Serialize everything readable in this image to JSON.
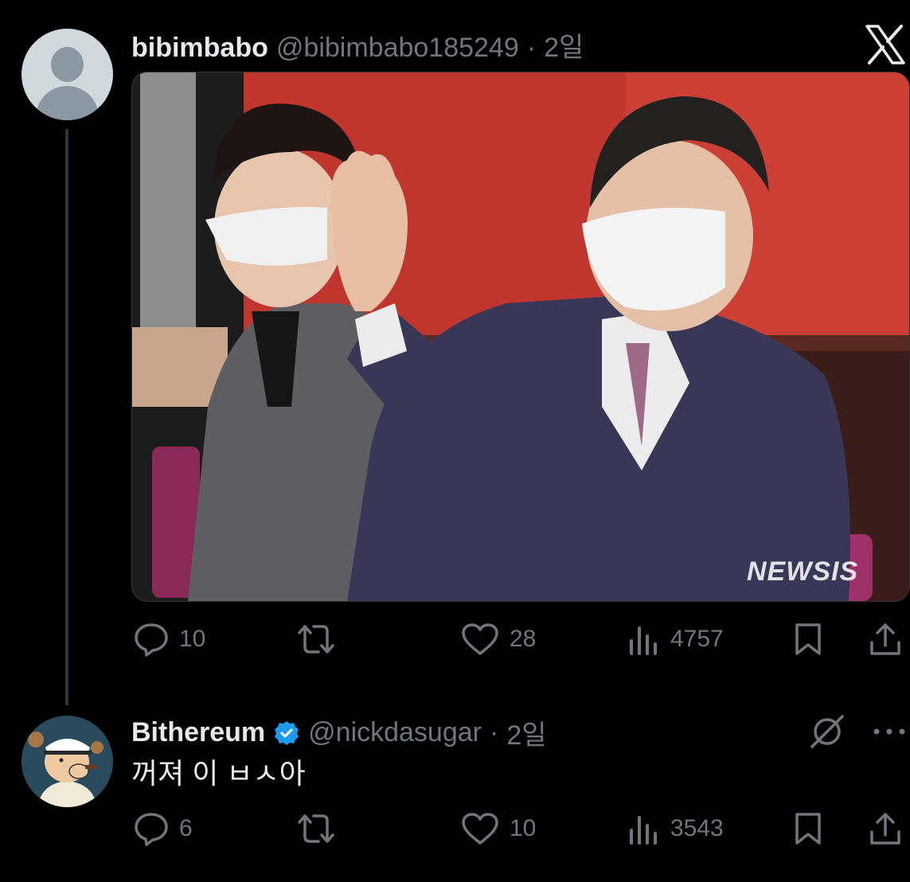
{
  "tweet": {
    "display_name": "bibimbabo",
    "handle": "@bibimbabo185249",
    "separator": "·",
    "time": "2일",
    "image_watermark": "NEWSIS",
    "metrics": {
      "replies": "10",
      "likes": "28",
      "views": "4757"
    }
  },
  "reply": {
    "display_name": "Bithereum",
    "handle": "@nickdasugar",
    "separator": "·",
    "time": "2일",
    "text": "꺼져 이 ㅂㅅ아",
    "metrics": {
      "replies": "6",
      "likes": "10",
      "views": "3543"
    }
  },
  "colors": {
    "background": "#000000",
    "primary_text": "#e7e9ea",
    "secondary_text": "#71767b",
    "verified_badge": "#1d9bf0",
    "divider": "#333639"
  },
  "icons": {
    "brand": "x-logo-icon",
    "reply": "reply-icon",
    "retweet": "retweet-icon",
    "like": "like-icon",
    "views": "views-icon",
    "bookmark": "bookmark-icon",
    "share": "share-icon",
    "verified": "verified-badge-icon",
    "grok": "grok-icon",
    "more": "more-icon"
  }
}
